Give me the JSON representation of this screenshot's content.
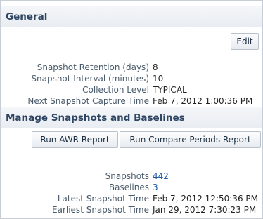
{
  "general": {
    "title": "General",
    "edit_label": "Edit",
    "fields": [
      {
        "label": "Snapshot Retention (days)",
        "value": "8"
      },
      {
        "label": "Snapshot Interval (minutes)",
        "value": "10"
      },
      {
        "label": "Collection Level",
        "value": "TYPICAL"
      },
      {
        "label": "Next Snapshot Capture Time",
        "value": "Feb 7, 2012 1:00:36 PM"
      }
    ]
  },
  "manage": {
    "title": "Manage Snapshots and Baselines",
    "run_awr_label": "Run AWR Report",
    "run_compare_label": "Run Compare Periods Report",
    "fields": [
      {
        "label": "Snapshots",
        "value": "442"
      },
      {
        "label": "Baselines",
        "value": "3"
      },
      {
        "label": "Latest Snapshot Time",
        "value": "Feb 7, 2012 12:50:36 PM"
      },
      {
        "label": "Earliest Snapshot Time",
        "value": "Jan 29, 2012 7:30:23 PM"
      }
    ]
  },
  "colors": {
    "header_text": "#2e4662",
    "label_text": "#4a5b6b",
    "link_text": "#1a57a5",
    "border": "#c8ced6"
  }
}
